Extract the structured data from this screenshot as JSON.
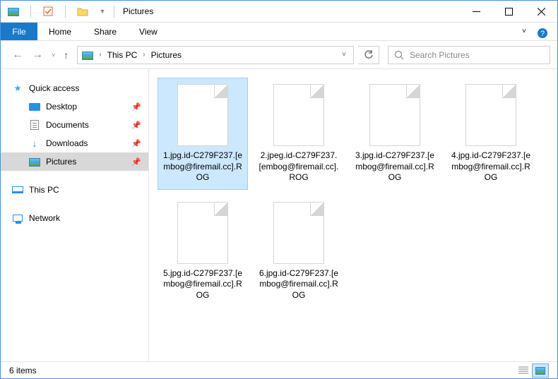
{
  "titlebar": {
    "title": "Pictures"
  },
  "ribbon": {
    "file": "File",
    "tabs": [
      "Home",
      "Share",
      "View"
    ]
  },
  "nav": {
    "breadcrumbs": [
      "This PC",
      "Pictures"
    ],
    "search_placeholder": "Search Pictures"
  },
  "sidebar": {
    "quick_access": "Quick access",
    "items": [
      {
        "label": "Desktop",
        "pinned": true
      },
      {
        "label": "Documents",
        "pinned": true
      },
      {
        "label": "Downloads",
        "pinned": true
      },
      {
        "label": "Pictures",
        "pinned": true,
        "selected": true
      }
    ],
    "this_pc": "This PC",
    "network": "Network"
  },
  "files": [
    {
      "name": "1.jpg.id-C279F237.[embog@firemail.cc].ROG",
      "selected": true
    },
    {
      "name": "2.jpeg.id-C279F237.[embog@firemail.cc].ROG"
    },
    {
      "name": "3.jpg.id-C279F237.[embog@firemail.cc].ROG"
    },
    {
      "name": "4.jpg.id-C279F237.[embog@firemail.cc].ROG"
    },
    {
      "name": "5.jpg.id-C279F237.[embog@firemail.cc].ROG"
    },
    {
      "name": "6.jpg.id-C279F237.[embog@firemail.cc].ROG"
    }
  ],
  "statusbar": {
    "count_text": "6 items"
  }
}
